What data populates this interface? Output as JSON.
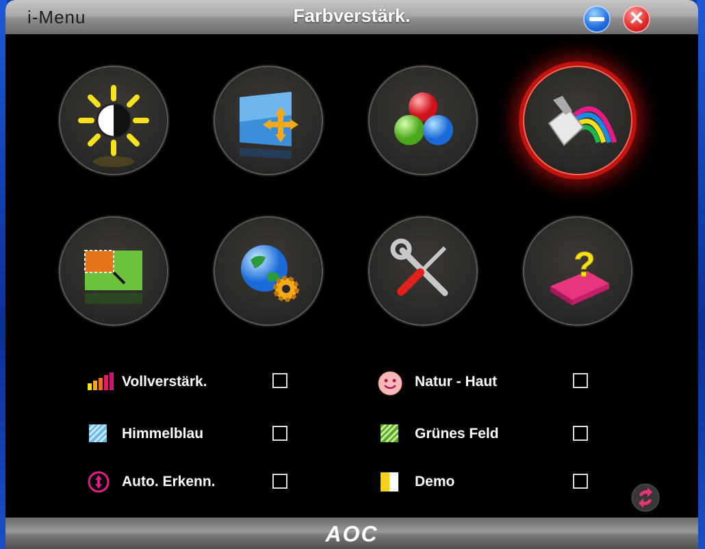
{
  "window": {
    "app_title": "i-Menu",
    "page_title": "Farbverstärk.",
    "minimize_icon": "minimize-icon",
    "close_icon": "close-icon"
  },
  "tiles": [
    {
      "name": "luminance",
      "icon": "brightness-icon"
    },
    {
      "name": "image-setup",
      "icon": "image-setup-icon"
    },
    {
      "name": "color-temp",
      "icon": "rgb-balls-icon"
    },
    {
      "name": "color-boost",
      "icon": "paint-bucket-rainbow-icon",
      "active": true
    },
    {
      "name": "picture-boost",
      "icon": "picture-boost-icon"
    },
    {
      "name": "osd-setup",
      "icon": "globe-gear-icon"
    },
    {
      "name": "extra",
      "icon": "tools-icon"
    },
    {
      "name": "help",
      "icon": "help-book-icon"
    }
  ],
  "options": [
    {
      "label": "Vollverstärk.",
      "icon": "signal-bars-icon",
      "checked": false
    },
    {
      "label": "Natur - Haut",
      "icon": "smiley-icon",
      "checked": false
    },
    {
      "label": "Himmelblau",
      "icon": "sky-blue-icon",
      "checked": false
    },
    {
      "label": "Grünes Feld",
      "icon": "green-field-icon",
      "checked": false
    },
    {
      "label": "Auto. Erkenn.",
      "icon": "auto-detect-icon",
      "checked": false
    },
    {
      "label": "Demo",
      "icon": "demo-icon",
      "checked": false
    }
  ],
  "footer": {
    "logo": "AOC",
    "refresh_icon": "refresh-icon"
  },
  "colors": {
    "active_glow": "#c0150f",
    "titlebar": "#a9a9a9",
    "background": "#000000"
  }
}
